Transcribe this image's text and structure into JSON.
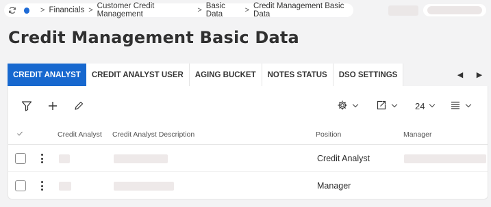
{
  "breadcrumb": {
    "items": [
      "Financials",
      "Customer Credit Management",
      "Basic Data",
      "Credit Management Basic Data"
    ],
    "separator": ">",
    "accent_color": "#1e6bd6"
  },
  "page": {
    "title": "Credit Management Basic Data"
  },
  "tabs": [
    {
      "label": "CREDIT ANALYST",
      "active": true
    },
    {
      "label": "CREDIT ANALYST USER",
      "active": false
    },
    {
      "label": "AGING BUCKET",
      "active": false
    },
    {
      "label": "NOTES STATUS",
      "active": false
    },
    {
      "label": "DSO SETTINGS",
      "active": false
    }
  ],
  "tab_nav": {
    "prev": "◀",
    "next": "▶"
  },
  "toolbar": {
    "icons": [
      "filter-icon",
      "add-icon",
      "edit-icon",
      "settings-icon",
      "export-icon",
      "density-icon"
    ],
    "page_size": "24"
  },
  "table": {
    "columns": [
      "Credit Analyst",
      "Credit Analyst Description",
      "Position",
      "Manager"
    ],
    "rows": [
      {
        "position": "Credit Analyst"
      },
      {
        "position": "Manager"
      }
    ]
  },
  "colors": {
    "tab_active": "#1768cf",
    "background": "#f3f3f4"
  }
}
